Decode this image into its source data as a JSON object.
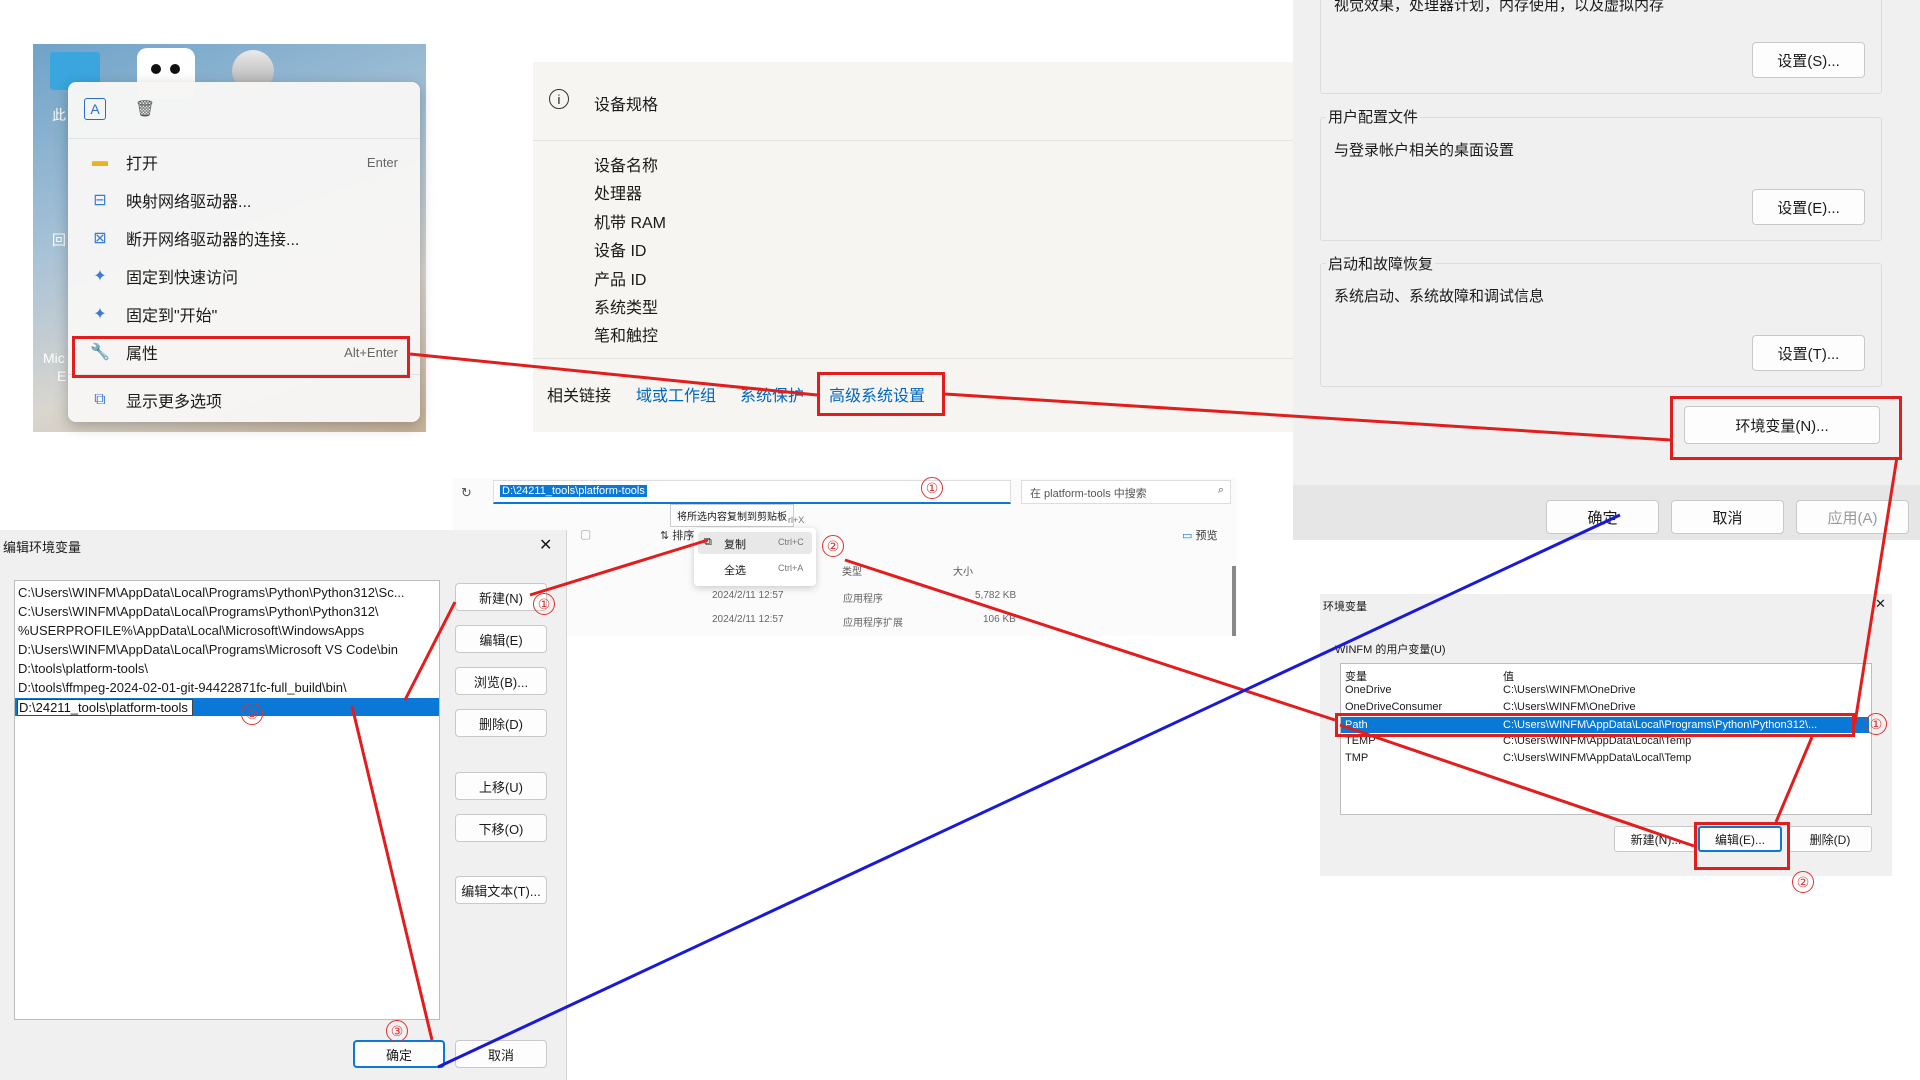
{
  "context_menu": {
    "items": [
      {
        "label": "打开",
        "shortcut": "Enter",
        "icon": "folder-icon"
      },
      {
        "label": "映射网络驱动器...",
        "shortcut": "",
        "icon": "network-drive-icon"
      },
      {
        "label": "断开网络驱动器的连接...",
        "shortcut": "",
        "icon": "disconnect-drive-icon"
      },
      {
        "label": "固定到快速访问",
        "shortcut": "",
        "icon": "pin-icon"
      },
      {
        "label": "固定到\"开始\"",
        "shortcut": "",
        "icon": "pin-start-icon"
      },
      {
        "label": "属性",
        "shortcut": "Alt+Enter",
        "icon": "wrench-icon"
      },
      {
        "label": "显示更多选项",
        "shortcut": "",
        "icon": "more-options-icon"
      }
    ],
    "desktop_labels": {
      "a": "此",
      "b": "回",
      "c": "Mic",
      "d": "E"
    }
  },
  "about": {
    "section_title": "设备规格",
    "specs": [
      "设备名称",
      "处理器",
      "机带 RAM",
      "设备 ID",
      "产品 ID",
      "系统类型",
      "笔和触控"
    ],
    "related_label": "相关链接",
    "links": [
      "域或工作组",
      "系统保护",
      "高级系统设置"
    ]
  },
  "sysprops": {
    "perf_desc": "视觉效果，处理器计划，内存使用，以及虚拟内存",
    "perf_button": "设置(S)...",
    "profile_title": "用户配置文件",
    "profile_desc": "与登录帐户相关的桌面设置",
    "profile_button": "设置(E)...",
    "startup_title": "启动和故障恢复",
    "startup_desc": "系统启动、系统故障和调试信息",
    "startup_button": "设置(T)...",
    "env_button": "环境变量(N)...",
    "ok": "确定",
    "cancel": "取消",
    "apply": "应用(A)"
  },
  "explorer": {
    "address": "D:\\24211_tools\\platform-tools",
    "search_placeholder": "在 platform-tools 中搜索",
    "tooltip": "将所选内容复制到剪贴板",
    "shortcut_x": "rl+X",
    "sort_label": "排序",
    "preview_label": "预览",
    "copy_label": "复制",
    "copy_shortcut": "Ctrl+C",
    "select_all_label": "全选",
    "select_all_shortcut": "Ctrl+A",
    "col_type": "类型",
    "col_size": "大小",
    "rows": [
      {
        "date": "2024/2/11 12:57",
        "type": "应用程序",
        "size": "5,782 KB"
      },
      {
        "date": "2024/2/11 12:57",
        "type": "应用程序扩展",
        "size": "106 KB"
      }
    ]
  },
  "edit_env": {
    "title": "编辑环境变量",
    "close": "✕",
    "paths": [
      "C:\\Users\\WINFM\\AppData\\Local\\Programs\\Python\\Python312\\Sc...",
      "C:\\Users\\WINFM\\AppData\\Local\\Programs\\Python\\Python312\\",
      "%USERPROFILE%\\AppData\\Local\\Microsoft\\WindowsApps",
      "D:\\Users\\WINFM\\AppData\\Local\\Programs\\Microsoft VS Code\\bin",
      "D:\\tools\\platform-tools\\",
      "D:\\tools\\ffmpeg-2024-02-01-git-94422871fc-full_build\\bin\\",
      "D:\\24211_tools\\platform-tools"
    ],
    "buttons": {
      "new": "新建(N)",
      "edit": "编辑(E)",
      "browse": "浏览(B)...",
      "delete": "删除(D)",
      "up": "上移(U)",
      "down": "下移(O)",
      "edit_text": "编辑文本(T)...",
      "ok": "确定",
      "cancel": "取消"
    }
  },
  "env_vars": {
    "title": "环境变量",
    "close": "✕",
    "user_label": "WINFM 的用户变量(U)",
    "col_var": "变量",
    "col_val": "值",
    "rows": [
      {
        "name": "OneDrive",
        "value": "C:\\Users\\WINFM\\OneDrive"
      },
      {
        "name": "OneDriveConsumer",
        "value": "C:\\Users\\WINFM\\OneDrive"
      },
      {
        "name": "Path",
        "value": "C:\\Users\\WINFM\\AppData\\Local\\Programs\\Python\\Python312\\..."
      },
      {
        "name": "TEMP",
        "value": "C:\\Users\\WINFM\\AppData\\Local\\Temp"
      },
      {
        "name": "TMP",
        "value": "C:\\Users\\WINFM\\AppData\\Local\\Temp"
      }
    ],
    "new": "新建(N)...",
    "edit": "编辑(E)...",
    "delete": "删除(D)"
  },
  "steps": {
    "one": "①",
    "two": "②",
    "three": "③"
  },
  "colors": {
    "accent": "#0078d4",
    "highlight": "#0a78d7",
    "annotation_red": "#e21d1d",
    "annotation_blue": "#1a1ad6"
  }
}
